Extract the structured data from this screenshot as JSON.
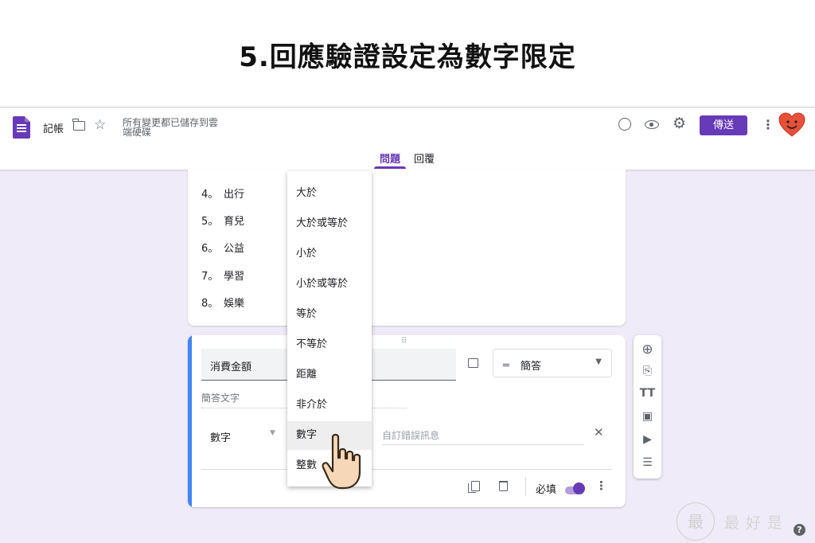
{
  "page_title": "5.回應驗證設定為數字限定",
  "header": {
    "doc_title": "記帳",
    "save_status": "所有變更都已儲存到雲端硬碟",
    "send_label": "傳送",
    "icons": [
      "forms-icon",
      "folder-icon",
      "star-icon",
      "palette-icon",
      "eye-icon",
      "gear-icon",
      "more-vert-icon"
    ],
    "accent_color": "#673ab7"
  },
  "tabs": [
    {
      "label": "問題",
      "active": true
    },
    {
      "label": "回覆",
      "active": false
    }
  ],
  "options": [
    {
      "num": "4。",
      "label": "出行"
    },
    {
      "num": "5。",
      "label": "育兒"
    },
    {
      "num": "6。",
      "label": "公益"
    },
    {
      "num": "7。",
      "label": "學習"
    },
    {
      "num": "8。",
      "label": "娛樂"
    }
  ],
  "question": {
    "title": "消費金額",
    "type": "簡答",
    "answer_hint": "簡答文字",
    "validation_type": "數字",
    "error_placeholder": "自訂錯誤訊息",
    "required_label": "必填",
    "required": true
  },
  "dropdown": {
    "items": [
      "大於",
      "大於或等於",
      "小於",
      "小於或等於",
      "等於",
      "不等於",
      "距離",
      "非介於",
      "數字",
      "整數"
    ],
    "selected": "數字"
  },
  "watermark": {
    "seal": "最",
    "text": "最好是"
  },
  "help": "?"
}
